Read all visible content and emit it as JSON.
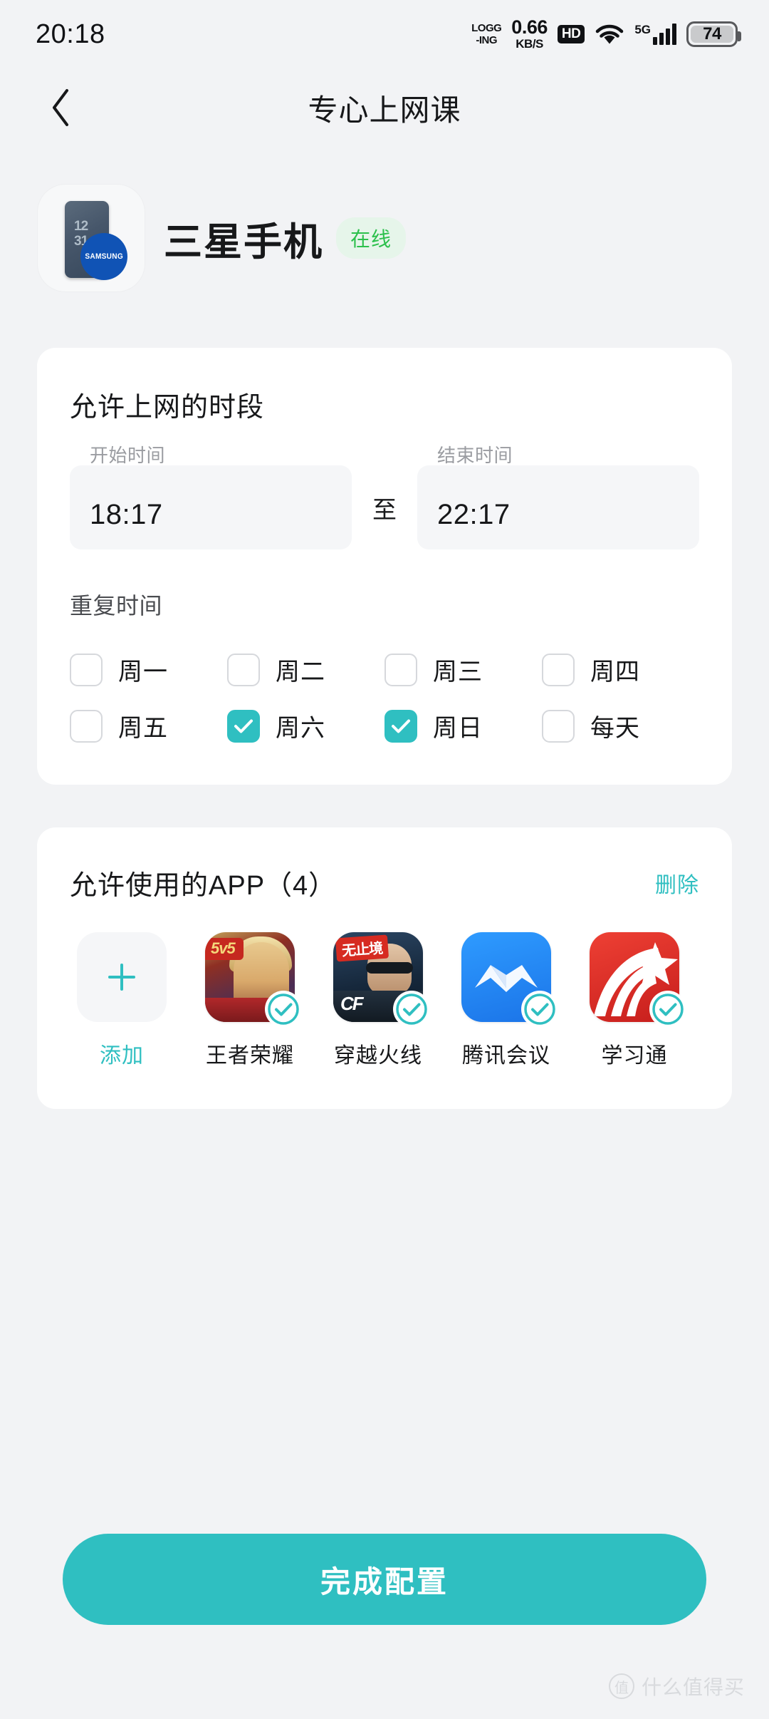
{
  "status_bar": {
    "time": "20:18",
    "logging_line1": "LOGG",
    "logging_line2": "-ING",
    "speed_value": "0.66",
    "speed_unit": "KB/S",
    "hd_label": "HD",
    "network_label": "5G",
    "battery_level": "74"
  },
  "nav": {
    "title": "专心上网课",
    "back_icon": "chevron-left-icon"
  },
  "device": {
    "name": "三星手机",
    "status_badge": "在线",
    "icon_clock_line1": "12",
    "icon_clock_line2": "31",
    "brand_label": "SAMSUNG"
  },
  "schedule_card": {
    "title": "允许上网的时段",
    "start_label": "开始时间",
    "start_value": "18:17",
    "separator": "至",
    "end_label": "结束时间",
    "end_value": "22:17",
    "repeat_label": "重复时间",
    "days": [
      {
        "label": "周一",
        "checked": false
      },
      {
        "label": "周二",
        "checked": false
      },
      {
        "label": "周三",
        "checked": false
      },
      {
        "label": "周四",
        "checked": false
      },
      {
        "label": "周五",
        "checked": false
      },
      {
        "label": "周六",
        "checked": true
      },
      {
        "label": "周日",
        "checked": true
      },
      {
        "label": "每天",
        "checked": false
      }
    ]
  },
  "apps_card": {
    "title": "允许使用的APP（4）",
    "delete_label": "删除",
    "add_label": "添加",
    "apps": [
      {
        "name": "王者荣耀",
        "selected": true,
        "icon": "honor-of-kings-icon",
        "badge_text": "5v5"
      },
      {
        "name": "穿越火线",
        "selected": true,
        "icon": "crossfire-icon",
        "badge_text": "无止境"
      },
      {
        "name": "腾讯会议",
        "selected": true,
        "icon": "tencent-meeting-icon",
        "badge_text": ""
      },
      {
        "name": "学习通",
        "selected": true,
        "icon": "chaoxing-icon",
        "badge_text": ""
      }
    ]
  },
  "footer": {
    "submit_label": "完成配置"
  },
  "watermark": {
    "mark": "值",
    "text": "什么值得买"
  },
  "colors": {
    "accent": "#2FBFC1",
    "online_green": "#2CC04C",
    "page_bg": "#F2F3F5",
    "card_bg": "#FFFFFF"
  }
}
